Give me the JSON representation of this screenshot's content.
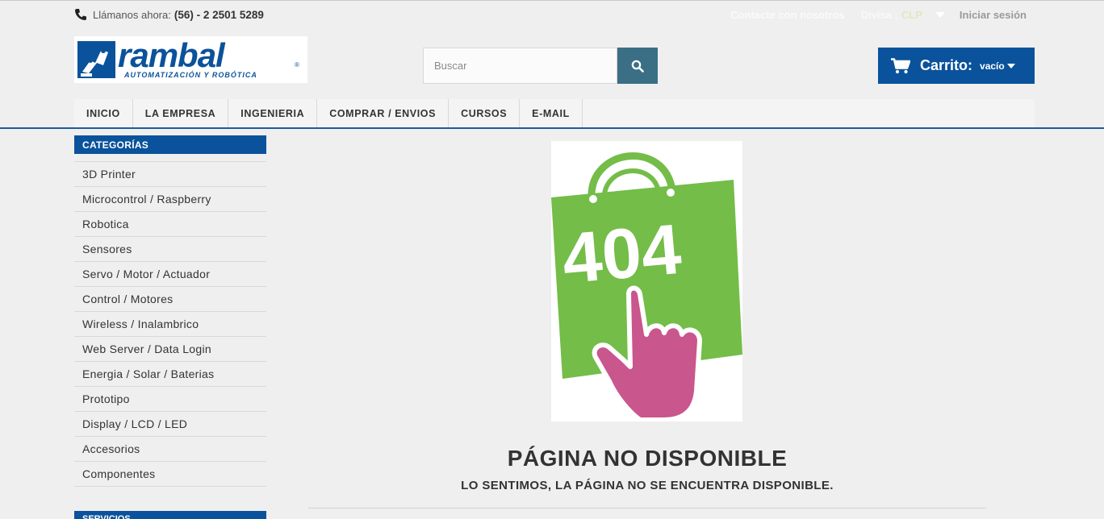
{
  "topbar": {
    "call_label": "Llámanos ahora:",
    "phone": "(56) - 2 2501 5289",
    "contact": "Contacte con nosotros",
    "currency_label": "Divisa :",
    "currency_value": "CLP",
    "login": "Iniciar sesión"
  },
  "logo": {
    "brand": "rambal",
    "tagline": "AUTOMATIZACIÓN Y ROBÓTICA"
  },
  "search": {
    "placeholder": "Buscar"
  },
  "cart": {
    "label": "Carrito:",
    "status": "vacío"
  },
  "nav": [
    "INICIO",
    "LA EMPRESA",
    "INGENIERIA",
    "COMPRAR / ENVIOS",
    "CURSOS",
    "E-MAIL"
  ],
  "sidebar": {
    "heading": "CATEGORÍAS",
    "items": [
      "3D Printer",
      "Microcontrol / Raspberry",
      "Robotica",
      "Sensores",
      "Servo / Motor / Actuador",
      "Control / Motores",
      "Wireless / Inalambrico",
      "Web Server / Data Login",
      "Energia / Solar / Baterias",
      "Prototipo",
      "Display / LCD / LED",
      "Accesorios",
      "Componentes"
    ],
    "heading2": "SERVICIOS"
  },
  "error": {
    "code": "404",
    "title": "PÁGINA NO DISPONIBLE",
    "subtitle": "LO SENTIMOS, LA PÁGINA NO SE ENCUENTRA DISPONIBLE."
  },
  "colors": {
    "brand_blue": "#0a529b",
    "search_button": "#3a6f86",
    "bag_green": "#73bd48",
    "hand_pink": "#c9568c"
  }
}
